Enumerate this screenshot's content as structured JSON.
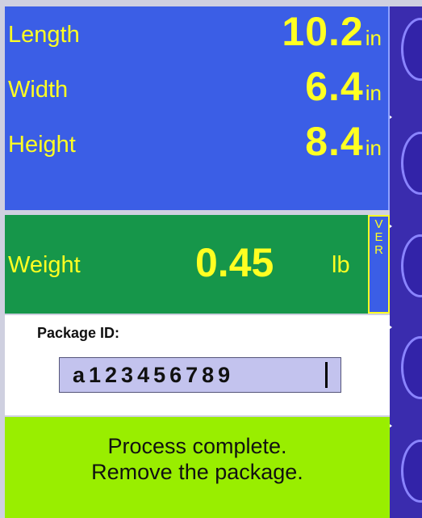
{
  "dimensions": {
    "length": {
      "label": "Length",
      "value": "10.2",
      "unit": "in"
    },
    "width": {
      "label": "Width",
      "value": "6.4",
      "unit": "in"
    },
    "height": {
      "label": "Height",
      "value": "8.4",
      "unit": "in"
    }
  },
  "weight": {
    "label": "Weight",
    "value": "0.45",
    "unit": "lb"
  },
  "ver_tab": {
    "letters": [
      "V",
      "E",
      "R"
    ]
  },
  "package": {
    "label": "Package ID:",
    "value": "a123456789"
  },
  "status": {
    "line1": "Process complete.",
    "line2": "Remove the package."
  },
  "colors": {
    "dimension_panel": "#3b5ee6",
    "weight_panel": "#16964a",
    "status_panel": "#99ee00",
    "value_text": "#ffff22",
    "softkey_column": "#3a2cae"
  },
  "softkeys": {
    "count": 5,
    "icon": "oval-softkey-icon"
  }
}
